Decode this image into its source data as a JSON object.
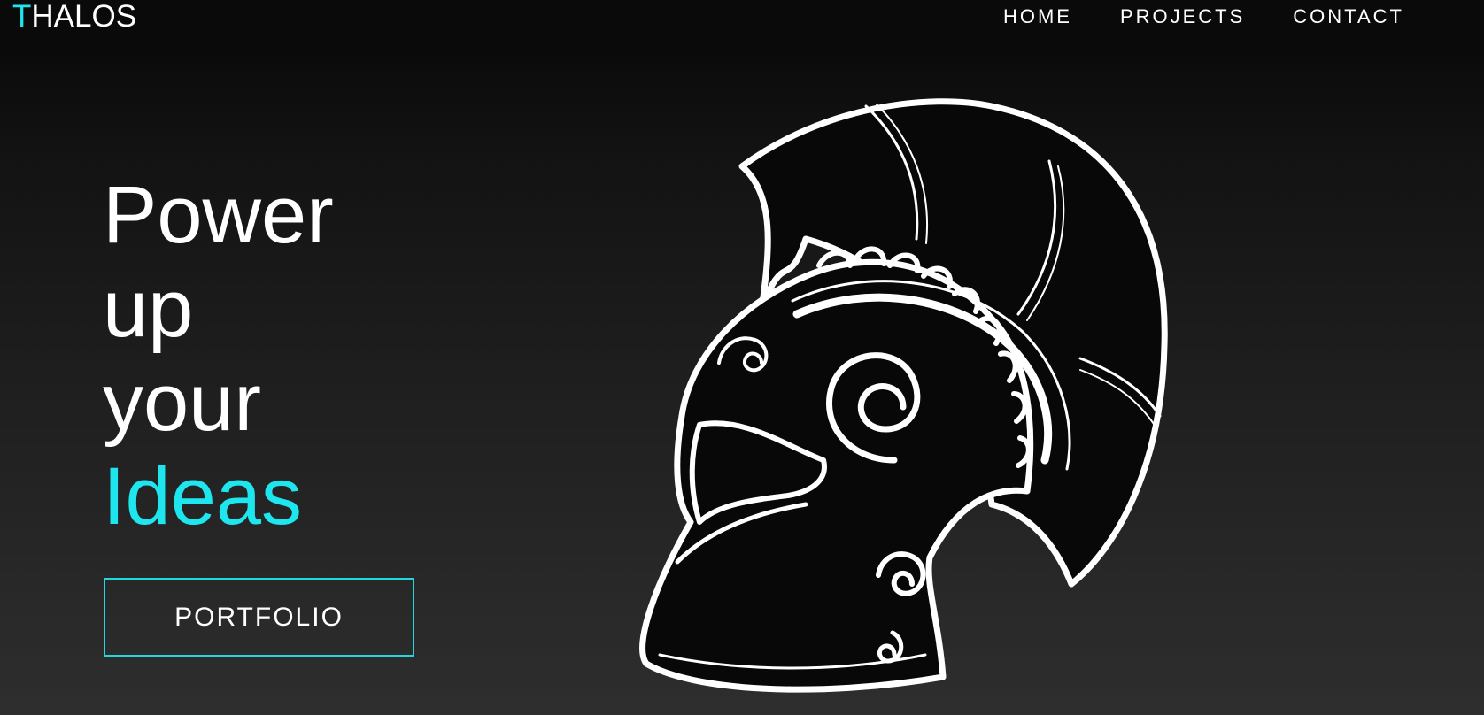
{
  "brand": {
    "logo_first_letter": "T",
    "logo_rest": "HALOS",
    "accent_color": "#1ee6ee"
  },
  "nav": {
    "items": [
      {
        "label": "HOME"
      },
      {
        "label": "PROJECTS"
      },
      {
        "label": "CONTACT"
      }
    ]
  },
  "hero": {
    "heading_lines": [
      "Power",
      "up",
      "your",
      "Ideas"
    ],
    "cta_label": "PORTFOLIO",
    "illustration": "spartan-helmet-icon"
  }
}
